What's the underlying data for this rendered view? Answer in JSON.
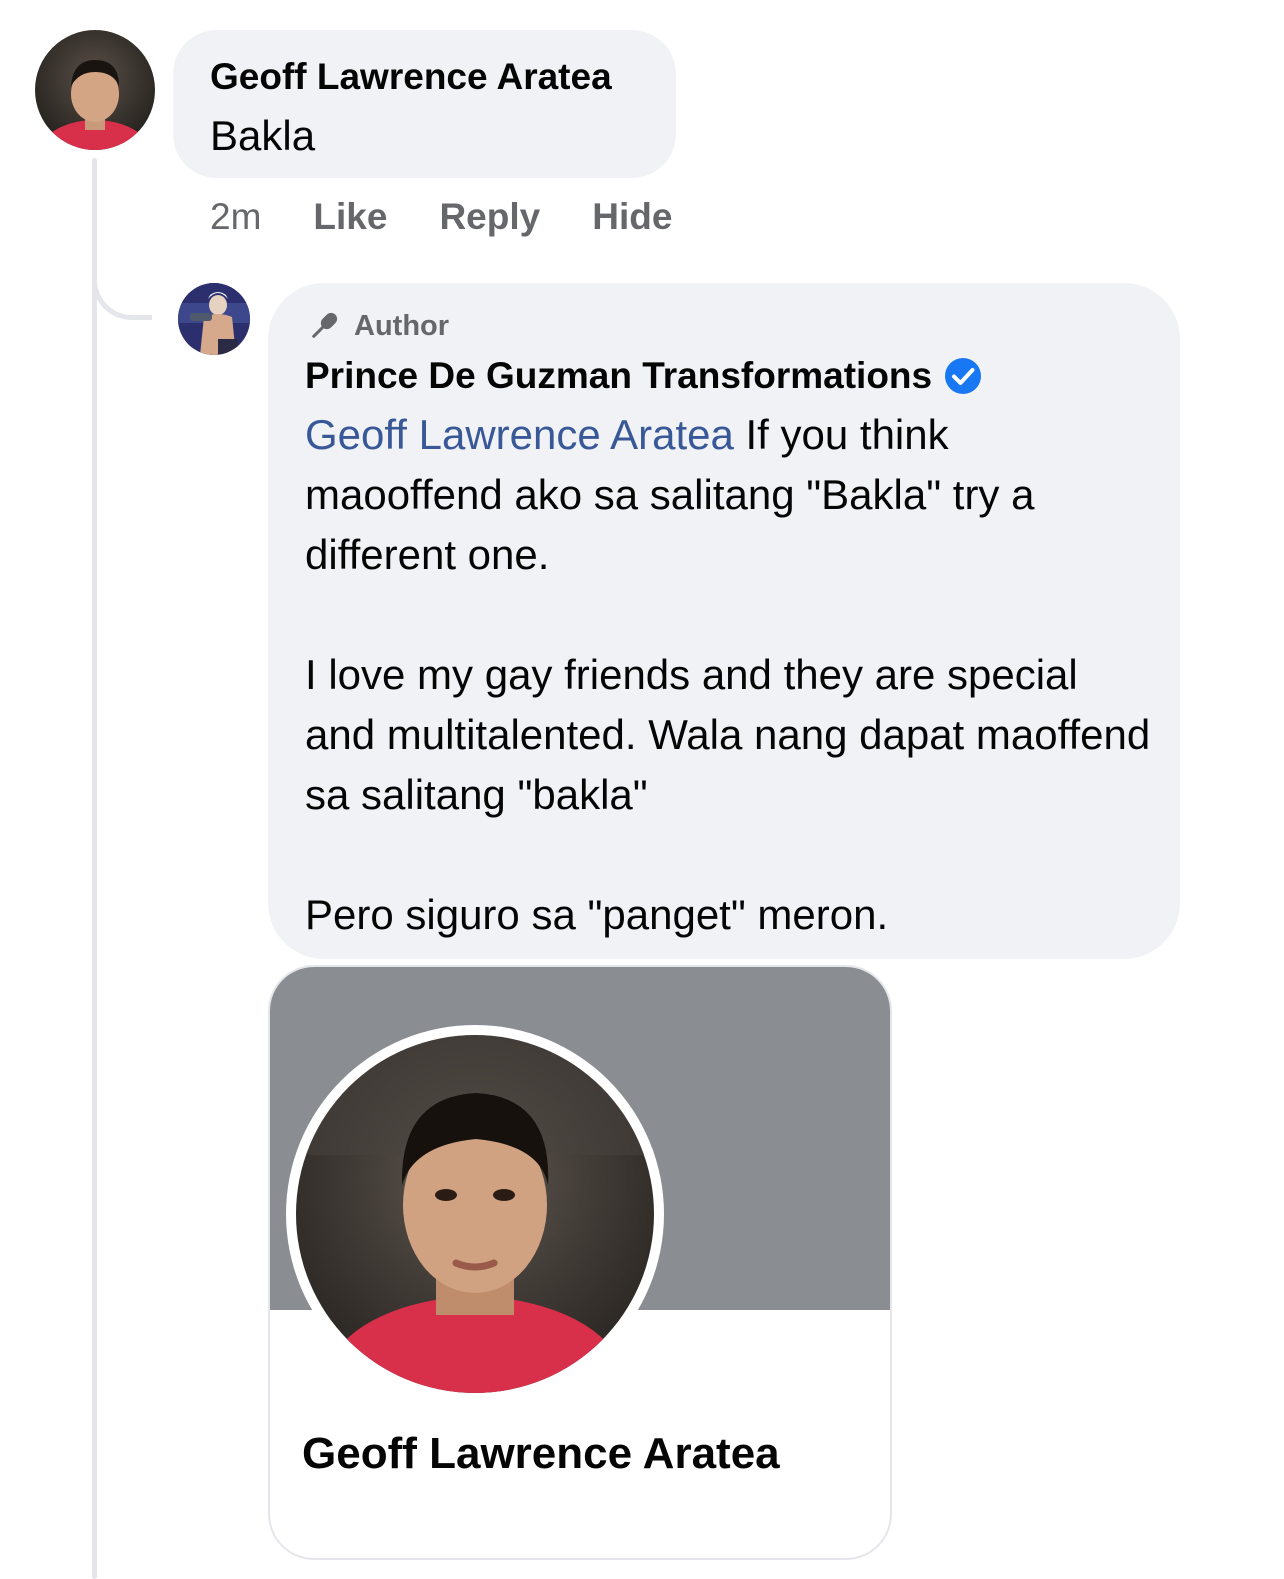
{
  "comment": {
    "author": "Geoff Lawrence Aratea",
    "text": "Bakla",
    "time": "2m",
    "actions": {
      "like": "Like",
      "reply": "Reply",
      "hide": "Hide"
    }
  },
  "reply": {
    "badge": "Author",
    "badge_icon": "microphone-icon",
    "page_name": "Prince De Guzman Transformations",
    "verified_icon": "verified-badge-icon",
    "mention": "Geoff Lawrence Aratea",
    "line1_rest": " If you think maooffend ako sa salitang \"Bakla\" try a different one.",
    "paragraph2": "I love my gay friends and they are special and multitalented. Wala nang dapat maoffend sa salitang \"bakla\"",
    "paragraph3": "Pero siguro sa \"panget\" meron."
  },
  "profile_card": {
    "name": "Geoff Lawrence Aratea"
  },
  "colors": {
    "bubble": "#f0f2f5",
    "mention": "#385898",
    "verified": "#1877f2",
    "secondary_text": "#65676b",
    "cover": "#8a8d91",
    "shirt_red": "#d8304a"
  }
}
